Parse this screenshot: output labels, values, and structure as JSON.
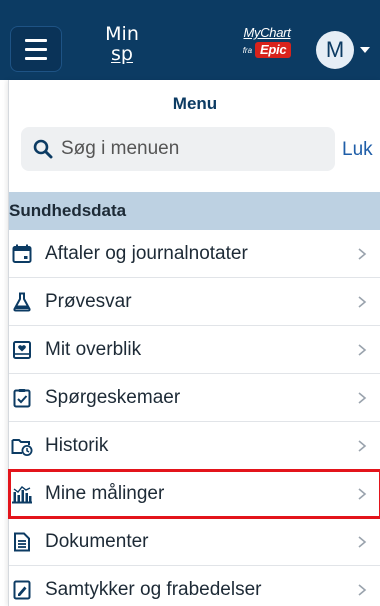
{
  "header": {
    "menu_button": "menu",
    "logo_line1": "Min",
    "logo_line2": "sp",
    "mychart_label": "MyChart",
    "mychart_fra": "fra",
    "mychart_epic": "Epic",
    "avatar_initial": "M"
  },
  "menu": {
    "title": "Menu",
    "search_placeholder": "Søg i menuen",
    "close_label": "Luk",
    "section_title": "Sundhedsdata",
    "items": [
      {
        "label": "Aftaler og journalnotater",
        "icon": "calendar-icon"
      },
      {
        "label": "Prøvesvar",
        "icon": "flask-icon"
      },
      {
        "label": "Mit overblik",
        "icon": "heart-card-icon"
      },
      {
        "label": "Spørgeskemaer",
        "icon": "clipboard-check-icon"
      },
      {
        "label": "Historik",
        "icon": "folder-clock-icon"
      },
      {
        "label": "Mine målinger",
        "icon": "chart-bars-icon",
        "highlighted": true
      },
      {
        "label": "Dokumenter",
        "icon": "document-icon"
      },
      {
        "label": "Samtykker og frabedelser",
        "icon": "signed-document-icon"
      }
    ]
  },
  "colors": {
    "header_bg": "#0c3b63",
    "section_bg": "#bdd1e2",
    "link": "#1f5ea8",
    "highlight": "#e3141b",
    "epic_red": "#d9231c"
  }
}
